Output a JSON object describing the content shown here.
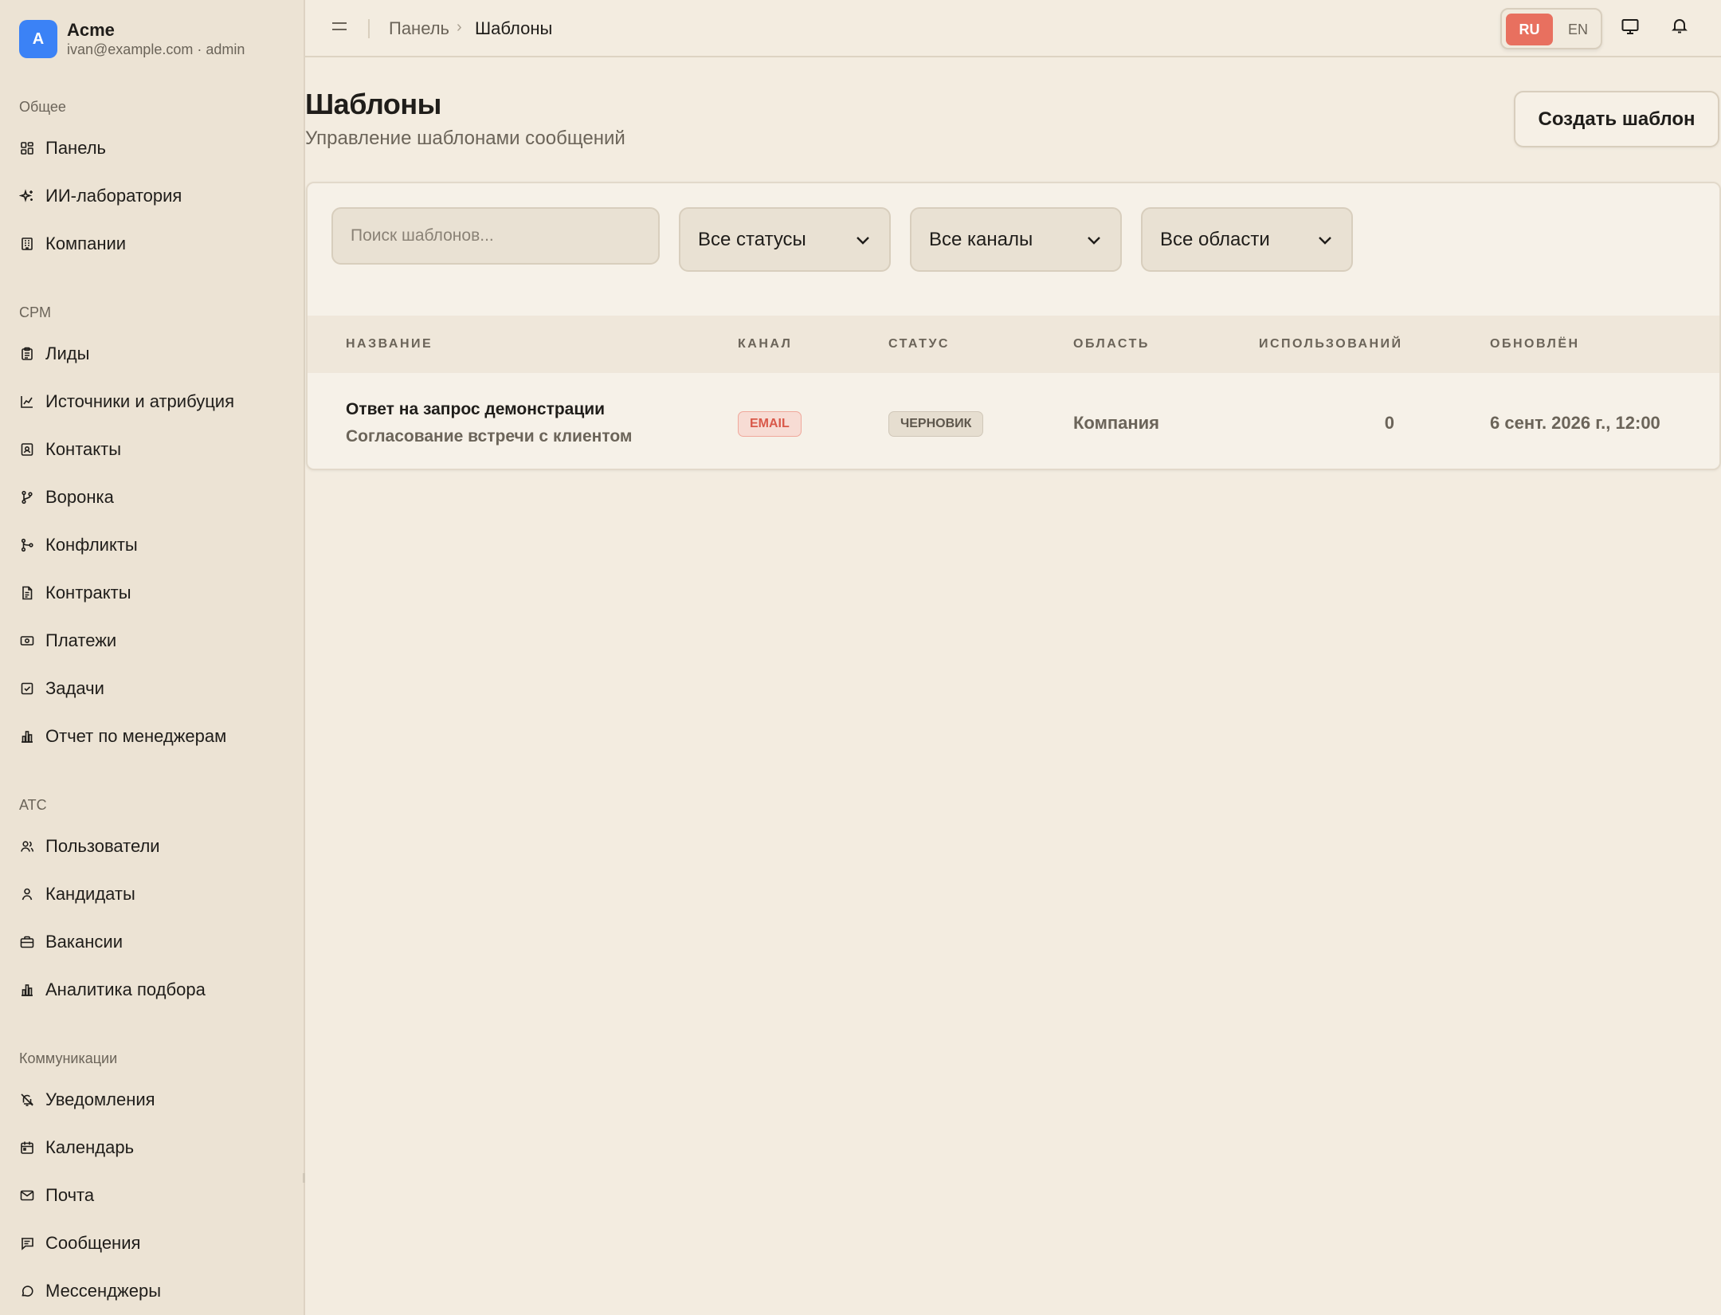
{
  "account": {
    "initial": "A",
    "name": "Acme",
    "subtitle": "ivan@example.com · admin"
  },
  "sidebar": {
    "sections": [
      {
        "label": "Общее",
        "items": [
          {
            "label": "Панель",
            "icon": "dashboard-icon"
          },
          {
            "label": "ИИ-лаборатория",
            "icon": "sparkles-icon"
          },
          {
            "label": "Компании",
            "icon": "building-icon"
          }
        ]
      },
      {
        "label": "CPM",
        "items": [
          {
            "label": "Лиды",
            "icon": "clipboard-icon"
          },
          {
            "label": "Источники и атрибуция",
            "icon": "chart-line-icon"
          },
          {
            "label": "Контакты",
            "icon": "contact-icon"
          },
          {
            "label": "Воронка",
            "icon": "git-branch-icon"
          },
          {
            "label": "Конфликты",
            "icon": "git-merge-icon"
          },
          {
            "label": "Контракты",
            "icon": "file-text-icon"
          },
          {
            "label": "Платежи",
            "icon": "banknote-icon"
          },
          {
            "label": "Задачи",
            "icon": "checkbox-icon"
          },
          {
            "label": "Отчет по менеджерам",
            "icon": "bar-chart-icon"
          }
        ]
      },
      {
        "label": "АТС",
        "items": [
          {
            "label": "Пользователи",
            "icon": "users-icon"
          },
          {
            "label": "Кандидаты",
            "icon": "user-icon"
          },
          {
            "label": "Вакансии",
            "icon": "briefcase-icon"
          },
          {
            "label": "Аналитика подбора",
            "icon": "bar-chart-icon"
          }
        ]
      },
      {
        "label": "Коммуникации",
        "items": [
          {
            "label": "Уведомления",
            "icon": "bell-off-icon"
          },
          {
            "label": "Календарь",
            "icon": "calendar-icon"
          },
          {
            "label": "Почта",
            "icon": "mail-icon"
          },
          {
            "label": "Сообщения",
            "icon": "message-square-icon"
          },
          {
            "label": "Мессенджеры",
            "icon": "message-circle-icon"
          }
        ]
      }
    ]
  },
  "topbar": {
    "breadcrumb_parent": "Панель",
    "breadcrumb_separator": "›",
    "breadcrumb_current": "Шаблоны",
    "lang_ru": "RU",
    "lang_en": "EN",
    "active_lang": "RU",
    "accent_color": "#e8705f"
  },
  "page": {
    "title": "Шаблоны",
    "subtitle": "Управление шаблонами сообщений",
    "create_button": "Создать шаблон"
  },
  "filters": {
    "search_placeholder": "Поиск шаблонов...",
    "search_value": "",
    "status": "Все статусы",
    "channel": "Все каналы",
    "scope": "Все области"
  },
  "table": {
    "columns": [
      "НАЗВАНИЕ",
      "КАНАЛ",
      "СТАТУС",
      "ОБЛАСТЬ",
      "ИСПОЛЬЗОВАНИЙ",
      "ОБНОВЛЁН"
    ],
    "rows": [
      {
        "name": "Ответ на запрос демонстрации",
        "description": "Согласование встречи с клиентом",
        "channel": "EMAIL",
        "status": "ЧЕРНОВИК",
        "scope": "Компания",
        "uses": "0",
        "updated": "6 сент. 2026 г., 12:00"
      }
    ]
  }
}
